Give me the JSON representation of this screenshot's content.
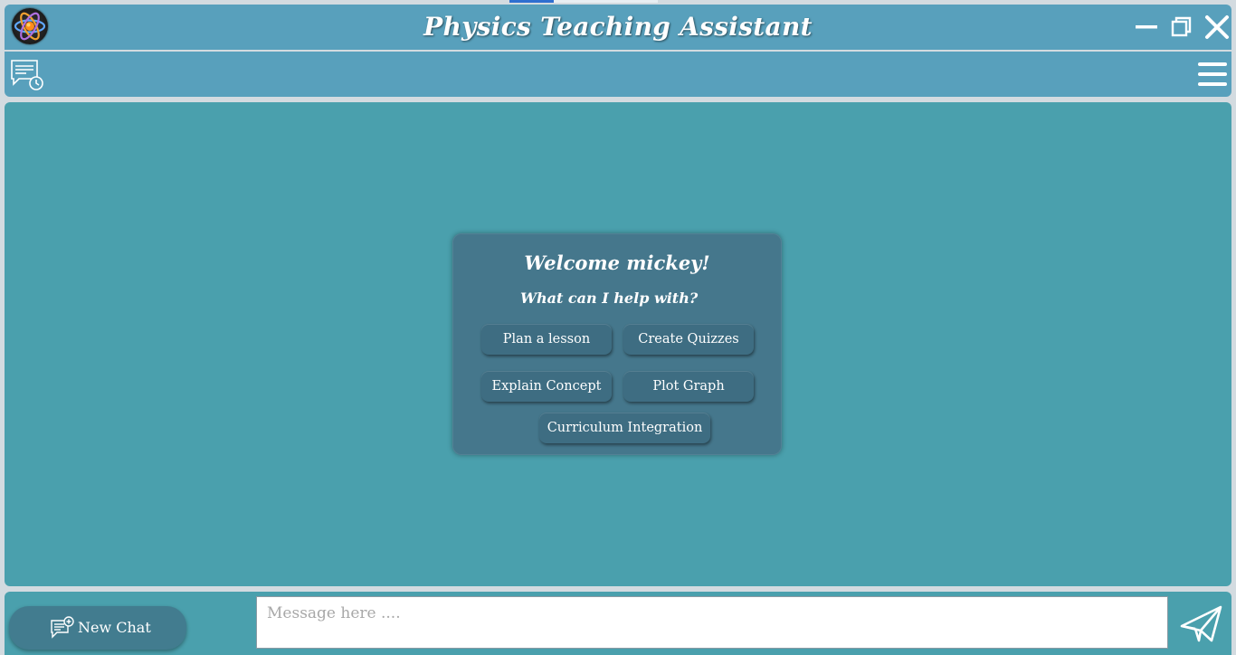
{
  "window": {
    "title": "Physics Teaching Assistant",
    "controls": [
      "minimize-icon",
      "restore-icon",
      "close-icon"
    ]
  },
  "toolbar": {
    "history_icon": "chat-history-icon",
    "menu_icon": "hamburger-menu-icon"
  },
  "welcome": {
    "title": "Welcome mickey!",
    "subtitle": "What can I help with?",
    "suggestions": [
      "Plan a lesson",
      "Create Quizzes",
      "Explain Concept",
      "Plot Graph",
      "Curriculum Integration"
    ]
  },
  "bottom": {
    "new_chat_label": "New Chat",
    "new_chat_icon": "new-chat-icon",
    "message_placeholder": "Message here ....",
    "message_value": "",
    "send_icon": "paper-plane-send-icon"
  },
  "colors": {
    "titlebar": "#58a0bc",
    "chat_background": "#4aa0ad",
    "card_background": "#45778c",
    "button_background": "#3e6d82",
    "text": "#ffffff"
  }
}
